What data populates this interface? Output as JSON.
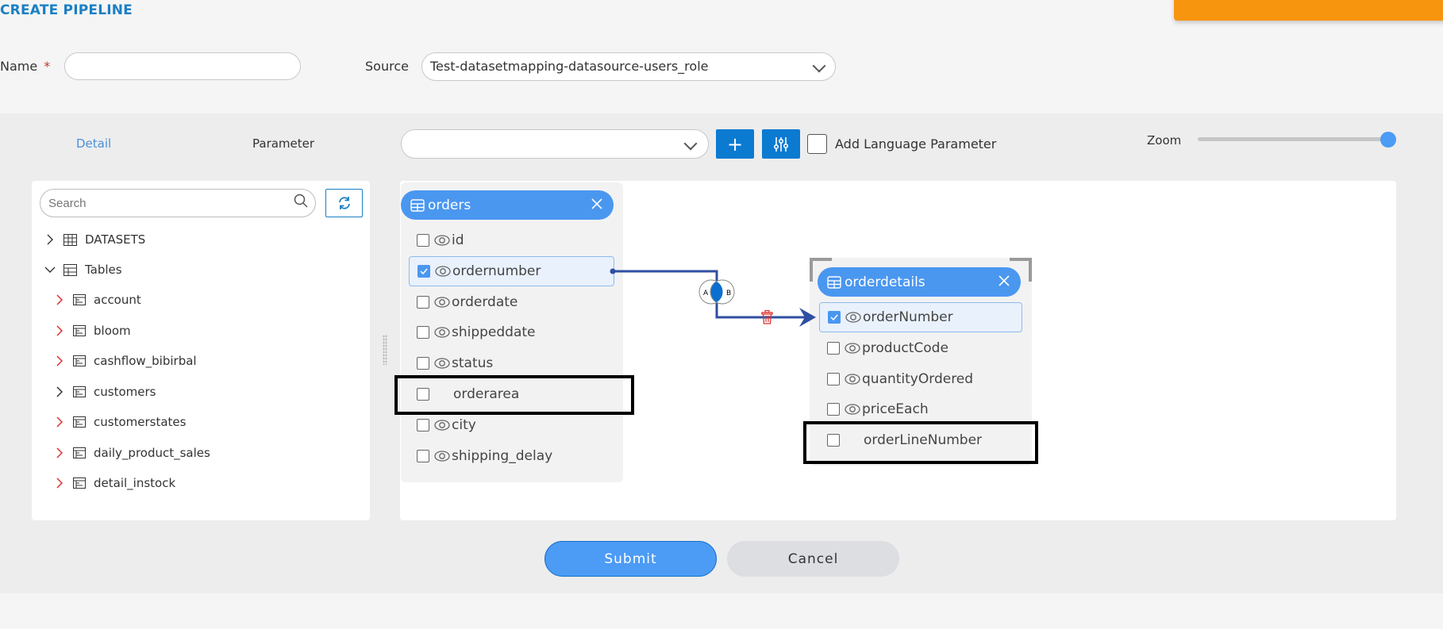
{
  "page": {
    "title": "CREATE PIPELINE"
  },
  "form": {
    "name_label": "Name",
    "name_required_mark": "*",
    "name_value": "",
    "source_label": "Source",
    "source_value": "Test-datasetmapping-datasource-users_role"
  },
  "tabs": [
    {
      "label": "Detail",
      "active": true
    },
    {
      "label": "Parameter",
      "active": false
    }
  ],
  "toolbar": {
    "parameter_select_value": "",
    "add_button_label": "+",
    "filter_icon": "sliders-icon",
    "add_language_parameter_label": "Add Language Parameter",
    "add_language_parameter_checked": false,
    "zoom_label": "Zoom",
    "zoom_level_fraction": 1.0
  },
  "sidebar": {
    "search_placeholder": "Search",
    "refresh_icon": "refresh-icon",
    "tree": [
      {
        "label": "DATASETS",
        "expanded": false,
        "icon": "grid-icon"
      },
      {
        "label": "Tables",
        "expanded": true,
        "icon": "table-icon",
        "children": [
          {
            "label": "account",
            "caret_color": "#e03030"
          },
          {
            "label": "bloom",
            "caret_color": "#e03030"
          },
          {
            "label": "cashflow_bibirbal",
            "caret_color": "#e03030"
          },
          {
            "label": "customers",
            "caret_color": "#333333"
          },
          {
            "label": "customerstates",
            "caret_color": "#e03030"
          },
          {
            "label": "daily_product_sales",
            "caret_color": "#e03030"
          },
          {
            "label": "detail_instock",
            "caret_color": "#e03030"
          }
        ]
      }
    ]
  },
  "canvas": {
    "tables": [
      {
        "name": "orders",
        "fields": [
          {
            "name": "id",
            "checked": false,
            "visible_icon": true
          },
          {
            "name": "ordernumber",
            "checked": true,
            "visible_icon": true,
            "selected": true
          },
          {
            "name": "orderdate",
            "checked": false,
            "visible_icon": true
          },
          {
            "name": "shippeddate",
            "checked": false,
            "visible_icon": true
          },
          {
            "name": "status",
            "checked": false,
            "visible_icon": true
          },
          {
            "name": "orderarea",
            "checked": false,
            "visible_icon": false,
            "highlighted": true
          },
          {
            "name": "city",
            "checked": false,
            "visible_icon": true
          },
          {
            "name": "shipping_delay",
            "checked": false,
            "visible_icon": true
          }
        ]
      },
      {
        "name": "orderdetails",
        "fields": [
          {
            "name": "orderNumber",
            "checked": true,
            "visible_icon": true,
            "selected": true
          },
          {
            "name": "productCode",
            "checked": false,
            "visible_icon": true
          },
          {
            "name": "quantityOrdered",
            "checked": false,
            "visible_icon": true
          },
          {
            "name": "priceEach",
            "checked": false,
            "visible_icon": true
          },
          {
            "name": "orderLineNumber",
            "checked": false,
            "visible_icon": false,
            "highlighted": true
          }
        ]
      }
    ],
    "join": {
      "from": "orders.ordernumber",
      "to": "orderdetails.orderNumber",
      "type": "inner",
      "venn_left": "A",
      "venn_right": "B",
      "line_color": "#2f4fa2",
      "delete_icon_color": "#e03030"
    }
  },
  "actions": {
    "submit_label": "Submit",
    "cancel_label": "Cancel"
  },
  "colors": {
    "accent": "#1a7fc4",
    "primary_button": "#4c9bf5",
    "toolbar_button": "#0b7ad1",
    "table_header": "#4a97f0",
    "orange_banner": "#f7950f"
  }
}
